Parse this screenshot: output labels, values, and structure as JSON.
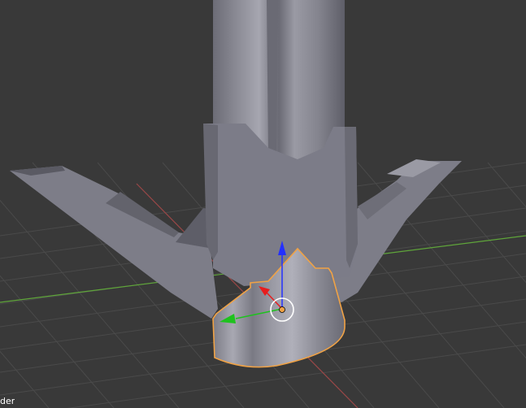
{
  "viewport": {
    "label": "der",
    "background_color": "#393939",
    "grid_line_color": "#4a4a4a",
    "x_axis_line_color": "#9a4747",
    "y_axis_line_color": "#5fa53a"
  },
  "object": {
    "body_color": "#7a7a86",
    "selection_outline_color": "#f0a245"
  },
  "gizmo": {
    "z_axis_color": "#2430ff",
    "x_axis_color": "#e81d1d",
    "y_axis_color": "#1ec21e",
    "pivot_color": "#f0a245"
  }
}
